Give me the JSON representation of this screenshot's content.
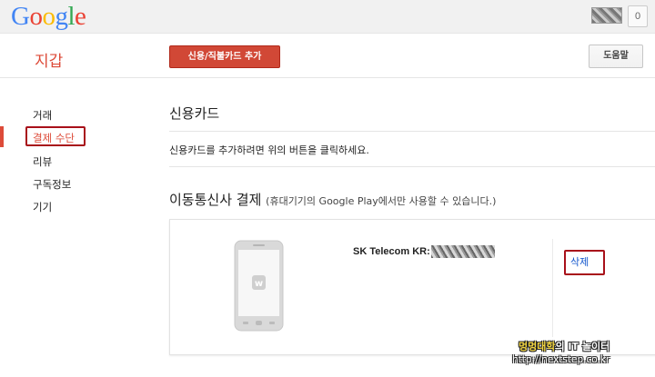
{
  "header": {
    "logo_letters": [
      {
        "ch": "G",
        "color": "#4285f4"
      },
      {
        "ch": "o",
        "color": "#ea4335"
      },
      {
        "ch": "o",
        "color": "#fbbc05"
      },
      {
        "ch": "g",
        "color": "#4285f4"
      },
      {
        "ch": "l",
        "color": "#34a853"
      },
      {
        "ch": "e",
        "color": "#ea4335"
      }
    ],
    "notification_count": "0"
  },
  "subheader": {
    "title": "지갑",
    "add_card_button": "신용/직불카드 추가",
    "help_button": "도움말"
  },
  "sidebar": {
    "items": [
      {
        "label": "거래",
        "active": false
      },
      {
        "label": "결제 수단",
        "active": true
      },
      {
        "label": "리뷰",
        "active": false
      },
      {
        "label": "구독정보",
        "active": false
      },
      {
        "label": "기기",
        "active": false
      }
    ]
  },
  "credit_card_section": {
    "title": "신용카드",
    "help_text": "신용카드를 추가하려면 위의 버튼을 클릭하세요."
  },
  "carrier_section": {
    "title": "이동통신사 결제",
    "note": "(휴대기기의 Google Play에서만 사용할 수 있습니다.)",
    "carrier_label": "SK Telecom KR:",
    "delete_link": "삭제"
  },
  "watermark": {
    "line1_a": "멍멍대학",
    "line1_b": "의 IT 놀이터",
    "line2": "http://nextstep.co.kr"
  },
  "colors": {
    "accent_red": "#dd4b39",
    "button_red": "#d14836",
    "link_blue": "#1155cc",
    "highlight_box": "#a8101a"
  }
}
